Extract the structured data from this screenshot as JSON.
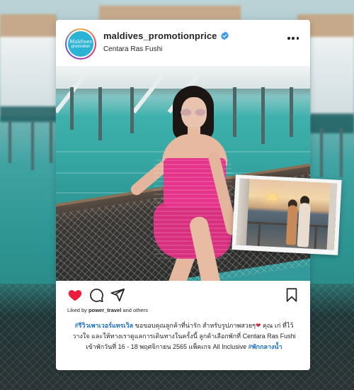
{
  "post": {
    "username": "maldives_promotionprice",
    "location": "Centara Ras Fushi",
    "avatar": {
      "line1": "Maldives",
      "line2": "promotion"
    },
    "liked_by_prefix": "Liked by ",
    "liked_by_user": "power_travel",
    "liked_by_suffix": " and others",
    "caption": {
      "hashtag1": "#รีวิวเพาเวอร์แทรเวิล",
      "part1": " ขอขอบคุณลูกค้าที่น่ารัก สำหรับรูปภาพสวยๆ",
      "heart": "❤",
      "part2": " คุณ เก่ ที่ไว้วางใจ และให้ทางเราดูแลการเดินทางในครั้งนี้ ลูกค้าเลือกพักที่ Centara Ras Fushi เข้าพักวันที่ 16 - 18 พฤศจิกายน 2565 แพ็คเกจ All Inclusive ",
      "hashtag2": "#พักกลางน้ำ"
    }
  },
  "icons": {
    "verified": "verified-badge-icon",
    "more": "more-options-icon",
    "like": "heart-icon",
    "comment": "comment-icon",
    "share": "share-icon",
    "save": "bookmark-icon"
  },
  "colors": {
    "like_red": "#ed1c3c",
    "verified_blue": "#3897f0",
    "hashtag_blue": "#1f6fc4",
    "dress_pink": "#e5358a"
  }
}
